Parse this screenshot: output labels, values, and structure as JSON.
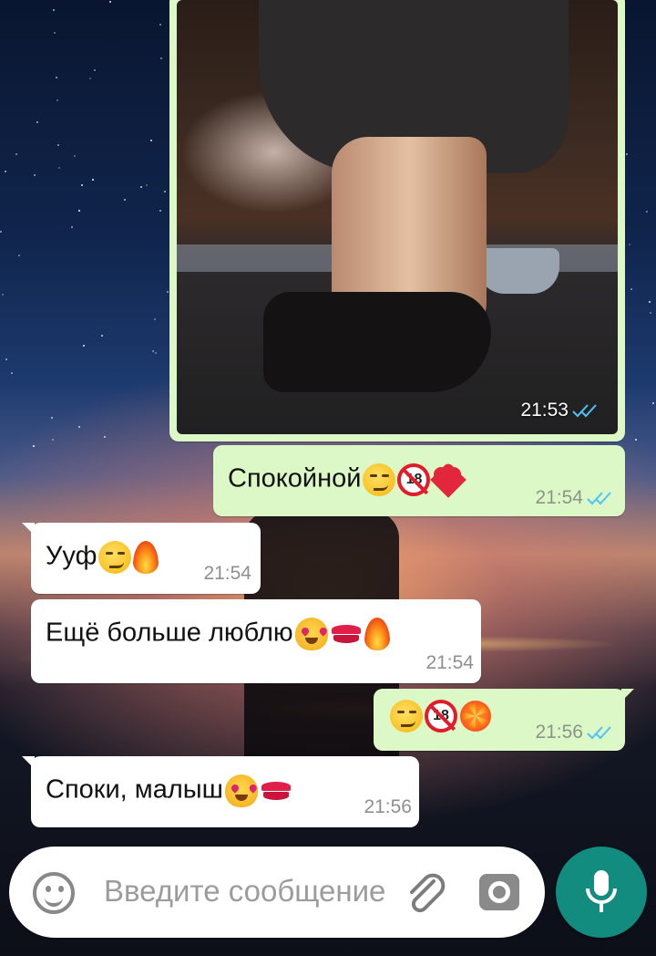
{
  "chat": {
    "messages": [
      {
        "direction": "outgoing",
        "type": "image",
        "time": "21:53",
        "status": "read"
      },
      {
        "direction": "outgoing",
        "type": "text",
        "text": "Спокойной",
        "emoji": [
          "smirk-emoji",
          "no-one-under-18-emoji",
          "red-heart-emoji"
        ],
        "time": "21:54",
        "status": "read"
      },
      {
        "direction": "incoming",
        "type": "text",
        "text": "Ууф",
        "emoji": [
          "smirk-emoji",
          "fire-emoji"
        ],
        "time": "21:54"
      },
      {
        "direction": "incoming",
        "type": "text",
        "text": "Ещё больше люблю",
        "emoji": [
          "heart-eyes-cat-emoji",
          "kiss-mark-emoji",
          "fire-emoji"
        ],
        "time": "21:54"
      },
      {
        "direction": "outgoing",
        "type": "text",
        "text": "",
        "emoji": [
          "smirk-emoji",
          "no-one-under-18-emoji",
          "collision-emoji"
        ],
        "time": "21:56",
        "status": "read"
      },
      {
        "direction": "incoming",
        "type": "text",
        "text": "Споки, малыш",
        "emoji": [
          "heart-eyes-cat-emoji",
          "kiss-mark-emoji"
        ],
        "time": "21:56"
      }
    ]
  },
  "composer": {
    "placeholder": "Введите сообщение",
    "icons": [
      "emoji-icon",
      "paperclip-icon",
      "camera-icon",
      "microphone-icon"
    ]
  },
  "colors": {
    "outgoing_bubble": "#dcf8c6",
    "incoming_bubble": "#ffffff",
    "read_ticks": "#4fc3f7",
    "mic_button": "#128c7e"
  }
}
